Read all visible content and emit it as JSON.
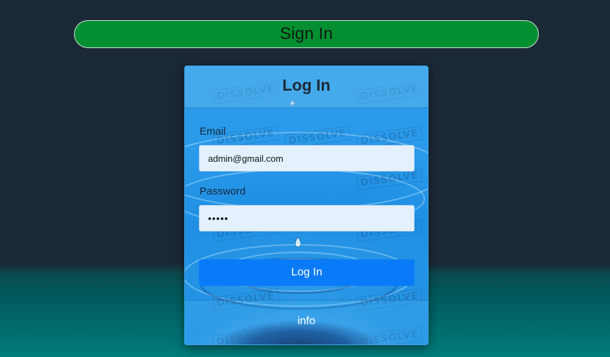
{
  "banner": {
    "title": "Sign In"
  },
  "card": {
    "title": "Log In",
    "watermark_text": "DISSOLVE",
    "email": {
      "label": "Email",
      "value": "admin@gmail.com"
    },
    "password": {
      "label": "Password",
      "value": "admin"
    },
    "submit_label": "Log In",
    "footer_text": "info"
  },
  "colors": {
    "background": "#1b2836",
    "background_bottom": "#017c7c",
    "banner": "#038f31",
    "button": "#0a7bf8",
    "field_bg": "#e4f0fc"
  }
}
